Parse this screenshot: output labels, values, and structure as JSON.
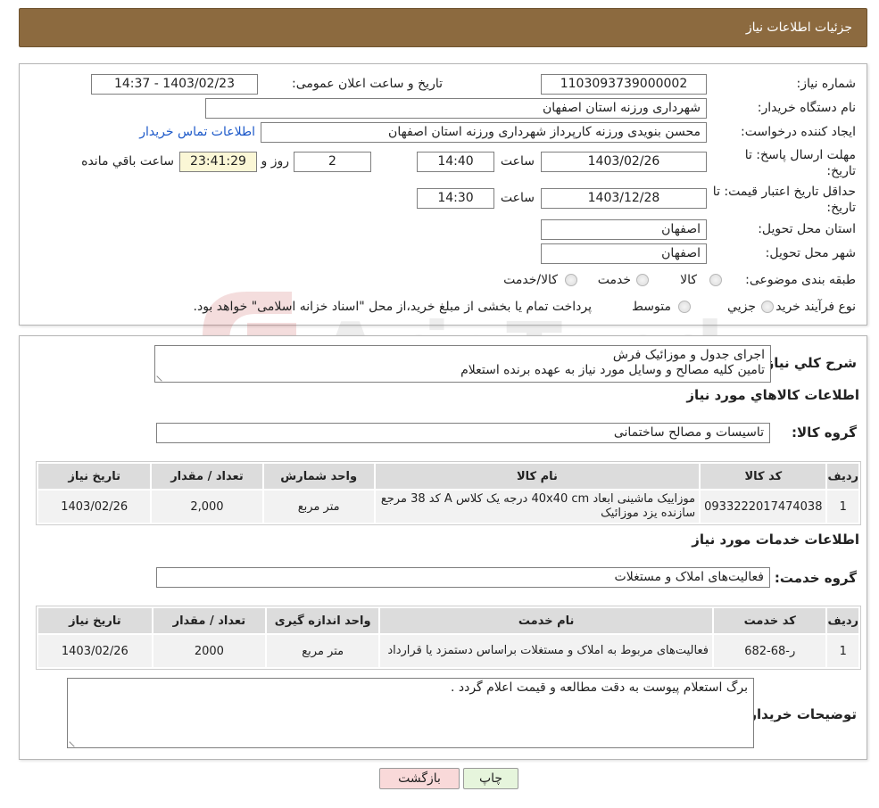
{
  "header": {
    "title": "جزئیات اطلاعات نیاز"
  },
  "form": {
    "need_number_label": "شماره نیاز:",
    "need_number": "1103093739000002",
    "announce_label": "تاریخ و ساعت اعلان عمومی:",
    "announce_value": "1403/02/23 - 14:37",
    "buyer_org_label": "نام دستگاه خریدار:",
    "buyer_org": "شهرداری ورزنه استان اصفهان",
    "creator_label": "ایجاد کننده درخواست:",
    "creator": "محسن بنویدی ورزنه کارپرداز شهرداری ورزنه استان اصفهان",
    "contact_link": "اطلاعات تماس خریدار",
    "deadline_label_1": "مهلت ارسال پاسخ: تا",
    "deadline_label_2": "تاریخ:",
    "deadline_date": "1403/02/26",
    "time_label": "ساعت",
    "deadline_time": "14:40",
    "days_value": "2",
    "days_label": "روز و",
    "remaining_time": "23:41:29",
    "remaining_label": "ساعت باقي مانده",
    "validity_label_1": "حداقل تاریخ اعتبار قیمت: تا",
    "validity_label_2": "تاریخ:",
    "validity_date": "1403/12/28",
    "validity_time": "14:30",
    "province_label": "استان محل تحویل:",
    "province": "اصفهان",
    "city_label": "شهر محل تحویل:",
    "city": "اصفهان",
    "category_label": "طبقه بندی موضوعی:",
    "category_options": [
      "کالا",
      "خدمت",
      "کالا/خدمت"
    ],
    "process_label": "نوع فرآیند خرید :",
    "process_options": [
      "جزیي",
      "متوسط"
    ],
    "process_note": "پرداخت تمام یا بخشی از مبلغ خرید،از محل \"اسناد خزانه اسلامی\" خواهد بود."
  },
  "summary": {
    "label": "شرح کلي نیاز:",
    "line1": "اجرای جدول و موزائیک فرش",
    "line2": "تامین کلیه مصالح و وسایل مورد نیاز به عهده برنده استعلام"
  },
  "goods": {
    "section_title": "اطلاعات کالاهاي مورد نیاز",
    "group_label": "گروه کالا:",
    "group_value": "تاسیسات و مصالح ساختمانی",
    "columns": [
      "ردیف",
      "کد کالا",
      "نام کالا",
      "واحد شمارش",
      "تعداد / مقدار",
      "تاریخ نیاز"
    ],
    "rows": [
      [
        "1",
        "0933222017474038",
        "موزاییک ماشینی ابعاد 40x40 cm درجه یک کلاس A کد 38 مرجع سازنده یزد موزائیک",
        "متر مربع",
        "2,000",
        "1403/02/26"
      ]
    ]
  },
  "services": {
    "section_title": "اطلاعات خدمات مورد نیاز",
    "group_label": "گروه خدمت:",
    "group_value": "فعالیت‌های  املاک و مستغلات",
    "columns": [
      "ردیف",
      "کد خدمت",
      "نام خدمت",
      "واحد اندازه گیری",
      "تعداد / مقدار",
      "تاریخ نیاز"
    ],
    "rows": [
      [
        "1",
        "ر-68-682",
        "فعالیت‌های مربوط به املاک و مستغلات براساس دستمزد یا قرارداد",
        "متر مربع",
        "2000",
        "1403/02/26"
      ]
    ]
  },
  "buyer_notes": {
    "label": "توضیحات خریدار:",
    "text": "برگ استعلام پیوست به دقت مطالعه و قیمت اعلام گردد ."
  },
  "buttons": {
    "print": "چاپ",
    "back": "بازگشت"
  },
  "colors": {
    "header_bg": "#8c6a3f",
    "link": "#1d59c9",
    "back_button_bg": "#f9d9d9",
    "print_button_bg": "#e6f5dc"
  }
}
